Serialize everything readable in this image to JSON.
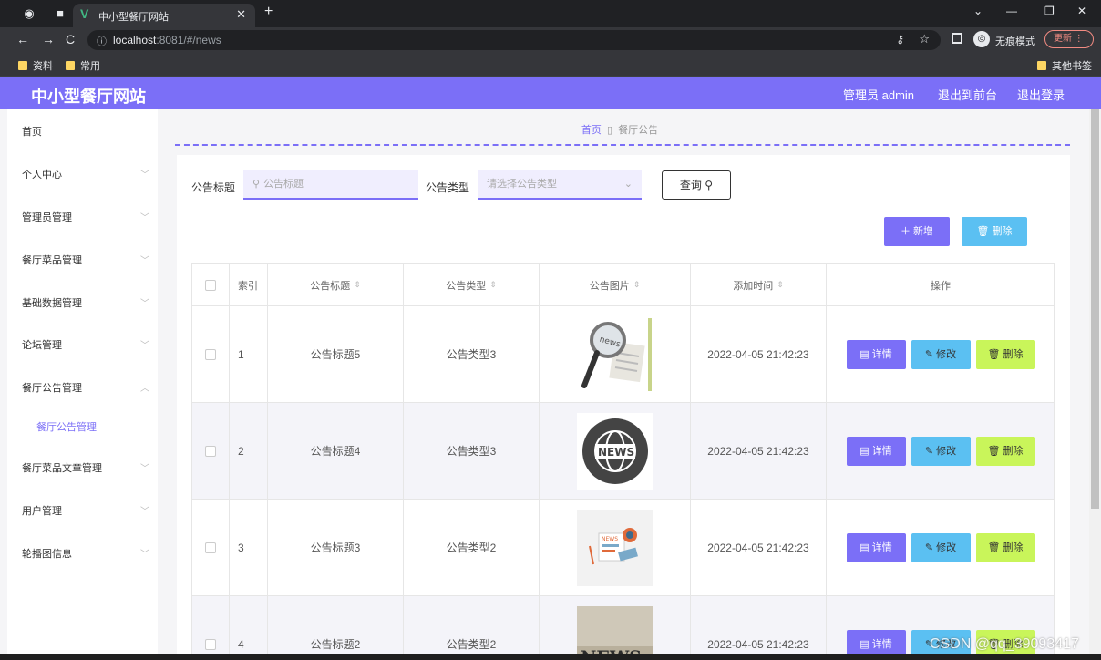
{
  "browser": {
    "tab_title": "中小型餐厅网站",
    "url_host": "localhost",
    "url_rest": ":8081/#/news",
    "incognito_label": "无痕模式",
    "update_label": "更新",
    "bookmarks": [
      "资料",
      "常用"
    ],
    "other_bookmarks": "其他书签"
  },
  "header": {
    "brand": "中小型餐厅网站",
    "admin": "管理员 admin",
    "to_front": "退出到前台",
    "logout": "退出登录"
  },
  "sidebar": {
    "items": [
      {
        "label": "首页"
      },
      {
        "label": "个人中心"
      },
      {
        "label": "管理员管理"
      },
      {
        "label": "餐厅菜品管理"
      },
      {
        "label": "基础数据管理"
      },
      {
        "label": "论坛管理"
      },
      {
        "label": "餐厅公告管理"
      },
      {
        "label": "餐厅菜品文章管理"
      },
      {
        "label": "用户管理"
      },
      {
        "label": "轮播图信息"
      }
    ],
    "sub_item": "餐厅公告管理"
  },
  "breadcrumb": {
    "home": "首页",
    "current": "餐厅公告"
  },
  "filter": {
    "title_label": "公告标题",
    "title_placeholder": "公告标题",
    "type_label": "公告类型",
    "type_placeholder": "请选择公告类型",
    "query_button": "查询"
  },
  "actions": {
    "add": "新增",
    "delete": "删除"
  },
  "table": {
    "headers": [
      "索引",
      "公告标题",
      "公告类型",
      "公告图片",
      "添加时间",
      "操作"
    ],
    "rows": [
      {
        "index": "1",
        "title": "公告标题5",
        "type": "公告类型3",
        "time": "2022-04-05 21:42:23"
      },
      {
        "index": "2",
        "title": "公告标题4",
        "type": "公告类型3",
        "time": "2022-04-05 21:42:23"
      },
      {
        "index": "3",
        "title": "公告标题3",
        "type": "公告类型2",
        "time": "2022-04-05 21:42:23"
      },
      {
        "index": "4",
        "title": "公告标题2",
        "type": "公告类型2",
        "time": "2022-04-05 21:42:23"
      }
    ],
    "row_actions": {
      "detail": "详情",
      "edit": "修改",
      "remove": "删除"
    },
    "image_text": {
      "news_label": "NEWS",
      "news_lower": "news"
    }
  },
  "watermark": "CSDN @qq_39093417",
  "colors": {
    "primary": "#7b6ff7",
    "info": "#5bc0f2",
    "lime": "#c9f55a"
  }
}
